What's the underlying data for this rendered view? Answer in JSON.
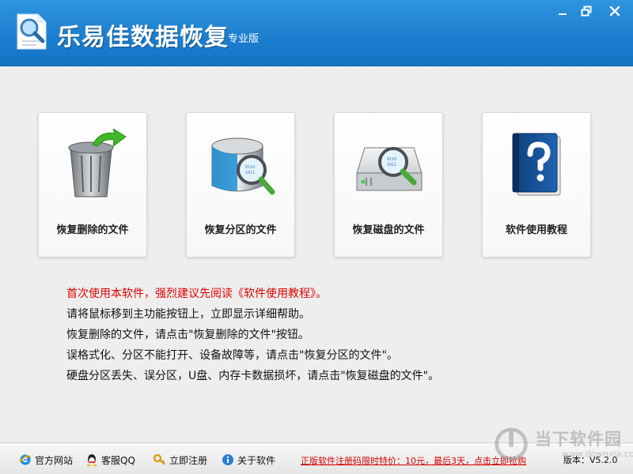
{
  "window": {
    "title": "乐易佳数据恢复",
    "edition": "专业版",
    "controls": {
      "minimize_icon": "minimize-icon",
      "maximize_icon": "restore-icon",
      "close_icon": "close-icon"
    }
  },
  "features": [
    {
      "label": "恢复删除的文件",
      "icon": "recycle-bin-icon"
    },
    {
      "label": "恢复分区的文件",
      "icon": "partition-search-icon"
    },
    {
      "label": "恢复磁盘的文件",
      "icon": "disk-search-icon"
    },
    {
      "label": "软件使用教程",
      "icon": "help-book-icon"
    }
  ],
  "tips": [
    "首次使用本软件，强烈建议先阅读《软件使用教程》。",
    "请将鼠标移到主功能按钮上，立即显示详细帮助。",
    "恢复删除的文件，请点击\"恢复删除的文件\"按钮。",
    "误格式化、分区不能打开、设备故障等，请点击\"恢复分区的文件\"。",
    "硬盘分区丢失、误分区，U盘、内存卡数据损坏，请点击\"恢复磁盘的文件\"。"
  ],
  "footer": {
    "links": [
      {
        "label": "官方网站",
        "icon": "ie-icon"
      },
      {
        "label": "客服QQ",
        "icon": "qq-icon"
      },
      {
        "label": "立即注册",
        "icon": "key-icon"
      },
      {
        "label": "关于软件",
        "icon": "info-icon"
      }
    ],
    "promo": "正版软件注册码限时特价：10元，最后3天，点击立即抢购",
    "version": "版本：V5.2.0"
  },
  "watermark": {
    "text": "当下软件园",
    "sub": "www.downxia.com"
  },
  "colors": {
    "titlebar": "#1c7fd0",
    "tip_highlight": "#e00000",
    "promo": "#d40000"
  }
}
